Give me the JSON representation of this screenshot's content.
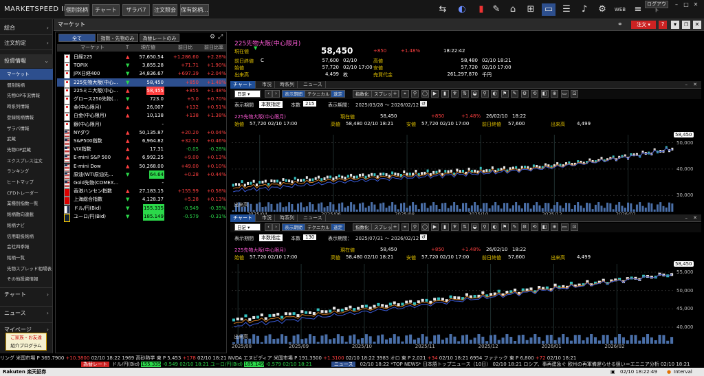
{
  "app": {
    "logo": "MARKETSPEED II"
  },
  "topbar": {
    "buttons": [
      "個別銘柄",
      "チャート",
      "ザラバ7",
      "注文照会",
      "保有銘柄..."
    ],
    "login": "ログアウト",
    "icons": [
      "trade-icon",
      "speedometer-icon",
      "market-alert-icon",
      "news-icon",
      "home-icon",
      "add-window-icon",
      "layout-icon",
      "list-icon",
      "bell-icon",
      "settings-icon",
      "web-icon",
      "menu-icon"
    ]
  },
  "sidebar": {
    "sections": [
      {
        "label": "総合"
      },
      {
        "label": "注文約定"
      },
      {
        "label": "投資情報"
      }
    ],
    "sub_items": [
      "マーケット",
      "個別銘柄",
      "先物OP市況情報",
      "時系列情報",
      "登録銘柄情報",
      "ザラバ情報",
      "武蔵",
      "先物OP武蔵",
      "エクスプレス注文",
      "ランキング",
      "ヒートマップ",
      "CFDトレーダー",
      "業種別指数一覧",
      "銘柄動向連載",
      "銘柄ナビ",
      "信用取扱銘柄",
      "会社四季報",
      "銘柄一覧",
      "先物スプレッド相場表",
      "その他投資情報"
    ],
    "bottom_sections": [
      {
        "label": "チャート"
      },
      {
        "label": "ニュース"
      },
      {
        "label": "マイページ"
      }
    ],
    "promo": [
      "ご家族・お友達",
      "紹介プログラム"
    ]
  },
  "market": {
    "title": "マーケット",
    "order_button": "注文",
    "filter_tabs": [
      "全て",
      "指数・先物のみ",
      "為替レートのみ"
    ],
    "columns": [
      "マーケット",
      "T",
      "現在値",
      "前日比",
      "前日比率"
    ],
    "rows": [
      {
        "flag": "jp",
        "name": "日経225",
        "trend": "up",
        "price": "57,650.54",
        "change": "+1,286.60",
        "pct": "+2.28%",
        "dir": "up"
      },
      {
        "flag": "jp",
        "name": "TOPIX",
        "trend": "dn",
        "price": "3,855.28",
        "change": "+71.71",
        "pct": "+1.90%",
        "dir": "up"
      },
      {
        "flag": "jp",
        "name": "JPX日経400",
        "trend": "dn",
        "price": "34,836.67",
        "change": "+697.39",
        "pct": "+2.04%",
        "dir": "up"
      },
      {
        "flag": "jp",
        "name": "225先物大阪(中心...",
        "trend": "dn",
        "price": "58,450",
        "change": "+850",
        "pct": "+1.48%",
        "dir": "up",
        "selected": true
      },
      {
        "flag": "jp",
        "name": "225ミニ大阪(中心...",
        "trend": "up",
        "price": "58,455",
        "change": "+855",
        "pct": "+1.48%",
        "dir": "up",
        "price_hl": "red"
      },
      {
        "flag": "jp",
        "name": "グロース250先物(...",
        "trend": "dn",
        "price": "723.0",
        "change": "+5.0",
        "pct": "+0.70%",
        "dir": "up"
      },
      {
        "flag": "jp",
        "name": "金(中心限月)",
        "trend": "up",
        "price": "26,007",
        "change": "+132",
        "pct": "+0.51%",
        "dir": "up"
      },
      {
        "flag": "jp",
        "name": "白金(中心限月)",
        "trend": "up",
        "price": "10,138",
        "change": "+138",
        "pct": "+1.38%",
        "dir": "up"
      },
      {
        "flag": "jp",
        "name": "銀(中心限月)",
        "trend": "",
        "price": "-",
        "change": "",
        "pct": "",
        "dir": "up"
      },
      {
        "flag": "us",
        "name": "NYダウ",
        "trend": "up",
        "price": "50,135.87",
        "change": "+20.20",
        "pct": "+0.04%",
        "dir": "up"
      },
      {
        "flag": "us",
        "name": "S&P500指数",
        "trend": "up",
        "price": "6,964.82",
        "change": "+32.52",
        "pct": "+0.46%",
        "dir": "up"
      },
      {
        "flag": "us",
        "name": "VIX指数",
        "trend": "up",
        "price": "17.31",
        "change": "-0.05",
        "pct": "-0.28%",
        "dir": "dn"
      },
      {
        "flag": "us",
        "name": "E-mini S&P 500",
        "trend": "up",
        "price": "6,992.25",
        "change": "+9.00",
        "pct": "+0.13%",
        "dir": "up"
      },
      {
        "flag": "us",
        "name": "E-mini Dow",
        "trend": "up",
        "price": "50,268.00",
        "change": "+49.00",
        "pct": "+0.10%",
        "dir": "up"
      },
      {
        "flag": "us",
        "name": "原油(WTI原油先...",
        "trend": "dn",
        "price": "64.64",
        "change": "+0.28",
        "pct": "+0.44%",
        "dir": "up",
        "price_hl": "green"
      },
      {
        "flag": "us",
        "name": "Gold先物(COMEX...",
        "trend": "",
        "price": "-",
        "change": "",
        "pct": "",
        "dir": "up"
      },
      {
        "flag": "cn",
        "name": "香港ハンセン指数",
        "trend": "up",
        "price": "27,183.15",
        "change": "+155.99",
        "pct": "+0.58%",
        "dir": "up"
      },
      {
        "flag": "cn",
        "name": "上海総合指数",
        "trend": "dn",
        "price": "4,128.37",
        "change": "+5.28",
        "pct": "+0.13%",
        "dir": "up"
      },
      {
        "flag": "jpus",
        "name": "ドル/円(Bid)",
        "trend": "dn",
        "price": "155.335",
        "change": "-0.549",
        "pct": "-0.35%",
        "dir": "dn",
        "price_hl": "green"
      },
      {
        "flag": "euro",
        "name": "ユーロ/円(Bid)",
        "trend": "dn",
        "price": "185.149",
        "change": "-0.579",
        "pct": "-0.31%",
        "dir": "dn",
        "price_hl": "green"
      }
    ]
  },
  "detail": {
    "title": "225先物大阪(中心限月)",
    "price_label": "現在値",
    "price": "58,450",
    "change": "+850",
    "pct": "+1.48%",
    "time": "18:22:42",
    "fields": [
      {
        "l": "前日終値",
        "c": "C",
        "v": "57,600",
        "d": "02/10"
      },
      {
        "l": "始値",
        "v": "57,720",
        "d": "02/10 17:00"
      },
      {
        "l": "出来高",
        "v": "4,499",
        "d": "枚"
      },
      {
        "l": "高値",
        "v": "58,480",
        "d": "02/10 18:21"
      },
      {
        "l": "安値",
        "v": "57,720",
        "d": "02/10 17:00"
      },
      {
        "l": "売買代金",
        "v": "261,297,870",
        "d": "千円"
      }
    ]
  },
  "charts": [
    {
      "tabs": [
        "チャート",
        "市況",
        "時系列",
        "ニュース"
      ],
      "interval": "日足",
      "toolbar": [
        "表示期間",
        "テクニカル",
        "速定",
        "指数化",
        "スプレッド"
      ],
      "period_label": "表示期間",
      "period_value": "本数指定",
      "count_label": "本数",
      "count": "215",
      "range_label": "表示期間：",
      "range": "2025/03/28 〜 2026/02/12",
      "info_title": "225先物大阪(中心限月)",
      "info_now_label": "現在値",
      "info_now": "58,450",
      "info_chg": "+850",
      "info_pct": "+1.48%",
      "info_date": "26/02/10",
      "info_time": "18:22",
      "info_fields": [
        {
          "l": "始値",
          "v": "57,720 02/10 17:00"
        },
        {
          "l": "高値",
          "v": "58,480 02/10 18:21"
        },
        {
          "l": "安値",
          "v": "57,720 02/10 17:00"
        },
        {
          "l": "前日終値",
          "v": "57,600"
        },
        {
          "l": "出来高",
          "v": "4,499"
        }
      ],
      "price_tag": "58,450",
      "y_ticks": [
        "50,000",
        "40,000",
        "30,000"
      ],
      "volume_label": "出来高",
      "x_ticks": [
        "2025/04",
        "2025/06",
        "2025/08",
        "2025/10",
        "2025/12",
        "2026/02"
      ]
    },
    {
      "tabs": [
        "チャート",
        "市況",
        "時系列",
        "ニュース"
      ],
      "interval": "日足",
      "toolbar": [
        "表示期間",
        "テクニカル",
        "速定",
        "指数化",
        "スプレッド"
      ],
      "period_label": "表示期間",
      "period_value": "本数指定",
      "count_label": "本数",
      "count": "130",
      "range_label": "表示期間：",
      "range": "2025/07/31 〜 2026/02/12",
      "info_title": "225先物大阪(中心限月)",
      "info_now_label": "現在値",
      "info_now": "58,450",
      "info_chg": "+850",
      "info_pct": "+1.48%",
      "info_date": "26/02/10",
      "info_time": "18:22",
      "info_fields": [
        {
          "l": "始値",
          "v": "57,720 02/10 17:00"
        },
        {
          "l": "高値",
          "v": "58,480 02/10 18:21"
        },
        {
          "l": "安値",
          "v": "57,720 02/10 17:00"
        },
        {
          "l": "前日終値",
          "v": "57,600"
        },
        {
          "l": "出来高",
          "v": "4,499"
        }
      ],
      "price_tag": "58,450",
      "y_ticks": [
        "55,000",
        "50,000",
        "45,000",
        "40,000"
      ],
      "volume_label": "出来高",
      "x_ticks": [
        "2025/08",
        "2025/09",
        "2025/10",
        "2025/11",
        "2025/12",
        "2026/01",
        "2026/02"
      ]
    }
  ],
  "ticker1": [
    {
      "t": "リング 米国市場 P 365.7900 ",
      "c": "#ddd"
    },
    {
      "t": "+10.3800",
      "c": "#ff4040"
    },
    {
      "t": " 02/10 18:22  1969 高砂熱学 東 P 5,453 ",
      "c": "#ddd"
    },
    {
      "t": "+178",
      "c": "#ff4040"
    },
    {
      "t": " 02/10 18:21  NVDA エヌビディア 米国市場 P 191.3500 ",
      "c": "#ddd"
    },
    {
      "t": "+1.3100",
      "c": "#ff4040"
    },
    {
      "t": " 02/10 18:22  3983 オロ 東 P 2,021 ",
      "c": "#ddd"
    },
    {
      "t": "+34",
      "c": "#ff4040"
    },
    {
      "t": " 02/10 18:21  6954 ファナック 東 P 6,800 ",
      "c": "#ddd"
    },
    {
      "t": "+72",
      "c": "#ff4040"
    },
    {
      "t": " 02/10 18:21  ",
      "c": "#ddd"
    }
  ],
  "ticker2": {
    "badge": "為替レート",
    "items": [
      {
        "t": "ドル/円(Bid) ",
        "c": "#ddd"
      },
      {
        "t": "155.335",
        "c": "#000",
        "bg": "#2bd84a"
      },
      {
        "t": " -0.549  02/10 18:21  ユーロ/円(Bid) ",
        "c": "#2bd84a"
      },
      {
        "t": "185.149",
        "c": "#000",
        "bg": "#2bd84a"
      },
      {
        "t": " -0.579  02/10 18:21",
        "c": "#2bd84a"
      }
    ],
    "news_badge": "ニュース",
    "news": "02/10 18:22  *TOP NEWS* 日本語トップニュース（10日）   02/10 18:21  ロシア、事再建急ぐ  欧州の再軍備遅らせる狙い＝エニニア分析  02/10 18:21"
  },
  "status": {
    "brand": "Rakuten 楽天証券",
    "datetime": "02/10 18:22:49",
    "interval": "Interval"
  },
  "colors": {
    "up": "#ff4040",
    "down": "#2bd84a",
    "accent": "#2d4f8e",
    "label": "#e0c000"
  }
}
